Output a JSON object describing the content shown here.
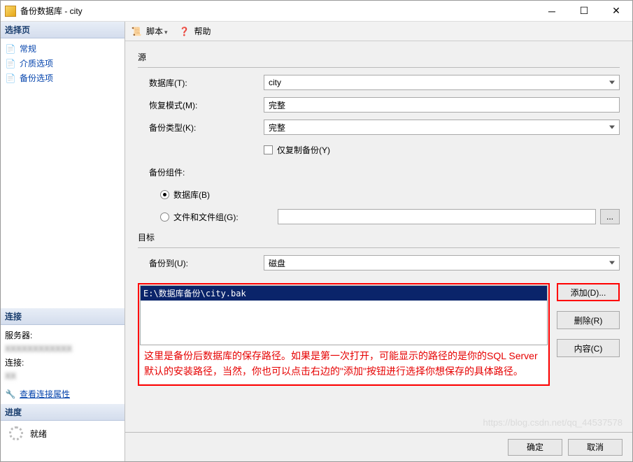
{
  "window": {
    "title": "备份数据库 - city"
  },
  "sidebar": {
    "select_page_header": "选择页",
    "items": [
      {
        "label": "常规"
      },
      {
        "label": "介质选项"
      },
      {
        "label": "备份选项"
      }
    ],
    "connection_header": "连接",
    "server_label": "服务器:",
    "connection_label": "连接:",
    "view_props": "查看连接属性",
    "progress_header": "进度",
    "progress_status": "就绪"
  },
  "toolbar": {
    "script": "脚本",
    "help": "帮助"
  },
  "form": {
    "source_header": "源",
    "database_label": "数据库(T):",
    "database_value": "city",
    "recovery_label": "恢复模式(M):",
    "recovery_value": "完整",
    "backup_type_label": "备份类型(K):",
    "backup_type_value": "完整",
    "copy_only_label": "仅复制备份(Y)",
    "component_label": "备份组件:",
    "component_db": "数据库(B)",
    "component_files": "文件和文件组(G):",
    "dest_header": "目标",
    "backup_to_label": "备份到(U):",
    "backup_to_value": "磁盘",
    "dest_path": "E:\\数据库备份\\city.bak",
    "annotation": "这里是备份后数据库的保存路径。如果是第一次打开，可能显示的路径的是你的SQL Server默认的安装路径，当然，你也可以点击右边的\"添加\"按钮进行选择你想保存的具体路径。",
    "add_btn": "添加(D)...",
    "remove_btn": "删除(R)",
    "contents_btn": "内容(C)",
    "browse_dots": "..."
  },
  "footer": {
    "ok": "确定",
    "cancel": "取消"
  },
  "watermark": "https://blog.csdn.net/qq_44537578"
}
